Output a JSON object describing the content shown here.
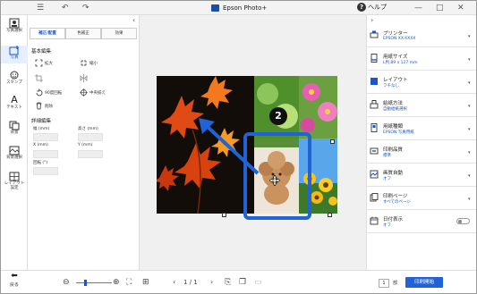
{
  "window": {
    "title": "Epson Photo+",
    "help": "ヘルプ"
  },
  "rail": {
    "items": [
      {
        "label": "写真選択"
      },
      {
        "label": "写真"
      },
      {
        "label": "スタンプ"
      },
      {
        "label": "テキスト"
      },
      {
        "label": "背景"
      },
      {
        "label": "背景選択"
      },
      {
        "label": "レイアウト設定"
      }
    ]
  },
  "edit_panel": {
    "tabs": [
      {
        "label": "補正/配置"
      },
      {
        "label": "色補正"
      },
      {
        "label": "効果"
      }
    ],
    "basic_title": "基本編集",
    "tools": {
      "zoom_in": "拡大",
      "zoom_out": "縮小",
      "rotate": "90度回転",
      "center": "中央揃え",
      "delete": "削除"
    },
    "detail_title": "詳細編集",
    "fields": {
      "width": "幅 (mm)",
      "height": "高さ (mm)",
      "x": "X (mm)",
      "y": "Y (mm)",
      "rotation": "回転 (°)"
    }
  },
  "canvas": {
    "step_number": "2"
  },
  "settings": {
    "rows": [
      {
        "title": "プリンター",
        "value": "EPSON XX-XXXX",
        "icon": "printer-icon"
      },
      {
        "title": "用紙サイズ",
        "value": "L判 89 x 127 mm",
        "icon": "paper-size-icon"
      },
      {
        "title": "レイアウト",
        "value": "フチなし",
        "icon": "layout-icon"
      },
      {
        "title": "給紙方法",
        "value": "自動給紙選択",
        "icon": "feed-icon"
      },
      {
        "title": "用紙種類",
        "value": "EPSON 写真用紙",
        "icon": "paper-type-icon"
      },
      {
        "title": "印刷品質",
        "value": "標準",
        "icon": "quality-icon"
      },
      {
        "title": "画質自動",
        "value": "オフ",
        "icon": "auto-image-icon"
      },
      {
        "title": "印刷ページ",
        "value": "すべてのページ",
        "icon": "pages-icon"
      },
      {
        "title": "日付表示",
        "value": "オフ",
        "icon": "date-icon"
      }
    ]
  },
  "bottom": {
    "back": "戻る",
    "page_indicator": "1 / 1",
    "copies": "1",
    "copies_unit": "部",
    "print": "印刷開始"
  },
  "colors": {
    "accent": "#1f63d6",
    "link": "#1a56c5"
  }
}
